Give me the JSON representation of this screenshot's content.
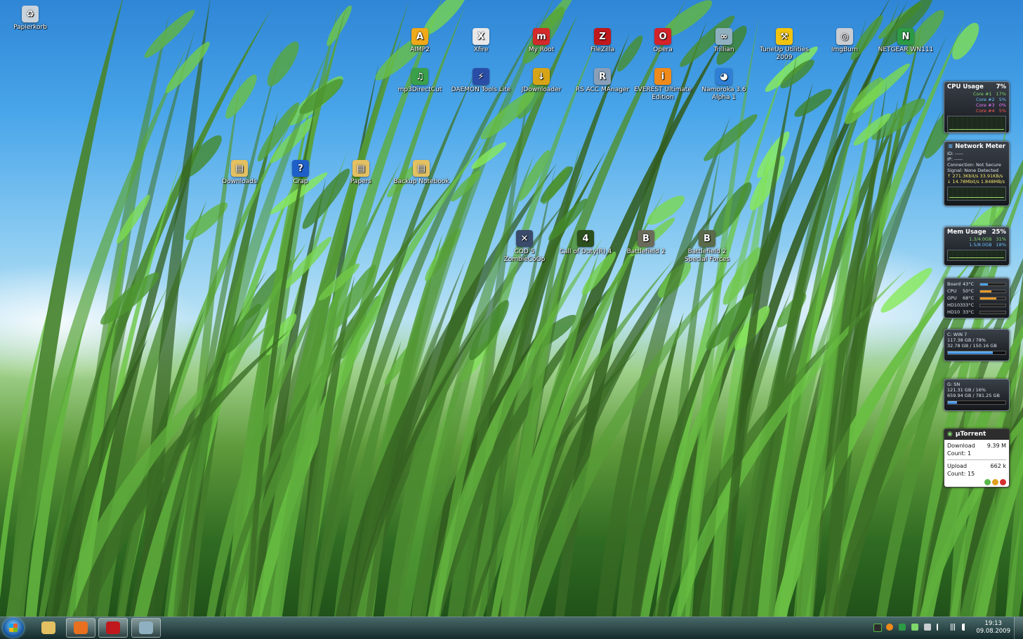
{
  "desktop": {
    "icons": [
      {
        "id": "recycle",
        "label": "Papierkorb",
        "icon": "recycle-bin-icon",
        "color": "#c9d3dc"
      },
      {
        "id": "aimp",
        "label": "AIMP2",
        "icon": "aimp-icon",
        "color": "#f0a91a"
      },
      {
        "id": "xfire",
        "label": "Xfire",
        "icon": "xfire-icon",
        "color": "#e8e8e8"
      },
      {
        "id": "myroot",
        "label": "My Root",
        "icon": "my-root-icon",
        "color": "#d52a2a"
      },
      {
        "id": "filezilla",
        "label": "FileZilla",
        "icon": "filezilla-icon",
        "color": "#c0181c"
      },
      {
        "id": "opera",
        "label": "Opera",
        "icon": "opera-icon",
        "color": "#d4232a"
      },
      {
        "id": "trillian",
        "label": "Trillian",
        "icon": "trillian-icon",
        "color": "#8fb0c0"
      },
      {
        "id": "tuneup",
        "label": "TuneUp Utilities 2009",
        "icon": "tuneup-icon",
        "color": "#f1c40f"
      },
      {
        "id": "imgburn",
        "label": "ImgBurn",
        "icon": "imgburn-icon",
        "color": "#c9cdd2"
      },
      {
        "id": "netgear",
        "label": "NETGEAR WN111",
        "icon": "netgear-icon",
        "color": "#2d9a45"
      },
      {
        "id": "mp3",
        "label": "mp3DirectCut",
        "icon": "mp3directcut-icon",
        "color": "#3aa04a"
      },
      {
        "id": "daemon",
        "label": "DAEMON Tools Lite",
        "icon": "daemon-tools-icon",
        "color": "#2a4ea8"
      },
      {
        "id": "jdownloader",
        "label": "JDownloader",
        "icon": "jdownloader-icon",
        "color": "#d7a418"
      },
      {
        "id": "rsacc",
        "label": "RS ACC MAnager",
        "icon": "rs-acc-icon",
        "color": "#8aa0b8"
      },
      {
        "id": "everest",
        "label": "EVEREST Ultimate Edition",
        "icon": "everest-icon",
        "color": "#f08a1a"
      },
      {
        "id": "namoroka",
        "label": "Namoroka 3.6 Alpha 1",
        "icon": "namoroka-icon",
        "color": "#2f7fd6"
      },
      {
        "id": "downloads",
        "label": "Downloads",
        "icon": "folder-icon",
        "color": "#e3c062"
      },
      {
        "id": "crap",
        "label": "Crap",
        "icon": "help-icon",
        "color": "#1f5fc8"
      },
      {
        "id": "papers",
        "label": "Papers",
        "icon": "folder-icon",
        "color": "#e3c062"
      },
      {
        "id": "backup",
        "label": "Backup Notebook",
        "icon": "folder-icon",
        "color": "#e3c062"
      },
      {
        "id": "cod5",
        "label": "COD 5 ZombieCoOp",
        "icon": "cod5-icon",
        "color": "#3a4a6a"
      },
      {
        "id": "cod4",
        "label": "Call of Duty(R) 4",
        "icon": "cod4-icon",
        "color": "#2c4f1e"
      },
      {
        "id": "bf2",
        "label": "Battlefield 2",
        "icon": "battlefield2-icon",
        "color": "#6a6a5a"
      },
      {
        "id": "bf2sf",
        "label": "Battlefield 2 Special Forces",
        "icon": "battlefield2-sf-icon",
        "color": "#5a6a4a"
      }
    ]
  },
  "gadgets": {
    "cpu": {
      "title": "CPU Usage",
      "value": "7%",
      "cores": [
        {
          "label": "Core #1",
          "value": "17%",
          "color": "#7fd66a"
        },
        {
          "label": "Core #2",
          "value": "5%",
          "color": "#6ac0ff"
        },
        {
          "label": "Core #3",
          "value": "0%",
          "color": "#e87aff"
        },
        {
          "label": "Core #4",
          "value": "5%",
          "color": "#ff5a5a"
        }
      ]
    },
    "network": {
      "title": "Network Meter",
      "id": "ID: -----",
      "ip": "IP: -----",
      "connection": "Connection: Not Secure",
      "signal": "Signal: None Detected",
      "up": "271.3Kbit/s  33.91KB/s",
      "down": "14.78Mbit/s  1.848MB/s"
    },
    "mem": {
      "title": "Mem Usage",
      "value": "25%",
      "rows": [
        {
          "label": "1.3/4.0GB",
          "value": "31%"
        },
        {
          "label": "1.5/8.0GB",
          "value": "18%"
        }
      ]
    },
    "temps": [
      {
        "label": "Board",
        "value": "43°C",
        "level": 0.3
      },
      {
        "label": "CPU",
        "value": "50°C",
        "level": 0.45
      },
      {
        "label": "GPU",
        "value": "68°C",
        "level": 0.65
      },
      {
        "label": "HD103",
        "value": "33°C",
        "level": 0.0
      },
      {
        "label": "HD10",
        "value": "33°C",
        "level": 0.0
      }
    ],
    "drive_c": {
      "name": "C: WIN 7",
      "line1": "117.38 GB / 78%",
      "line2": "32.78 GB / 150.16 GB",
      "fill": 0.78
    },
    "drive_g": {
      "name": "G: SN",
      "line1": "121.31 GB / 16%",
      "line2": "659.94 GB / 781.25 GB",
      "fill": 0.16
    },
    "utorrent": {
      "title": "µTorrent",
      "download_label": "Download",
      "download_value": "9.39 M",
      "download_count": "Count: 1",
      "upload_label": "Upload",
      "upload_value": "662 k",
      "upload_count": "Count: 15"
    }
  },
  "taskbar": {
    "pinned": [
      {
        "id": "explorer",
        "icon": "explorer-folder-icon",
        "color": "#e3c062"
      },
      {
        "id": "firefox",
        "icon": "firefox-icon",
        "color": "#e8701f"
      },
      {
        "id": "filezilla",
        "icon": "filezilla-icon",
        "color": "#c0181c"
      },
      {
        "id": "trillian",
        "icon": "trillian-icon",
        "color": "#8fb0c0"
      }
    ],
    "clock": {
      "time": "19:13",
      "date": "09.08.2009"
    }
  }
}
